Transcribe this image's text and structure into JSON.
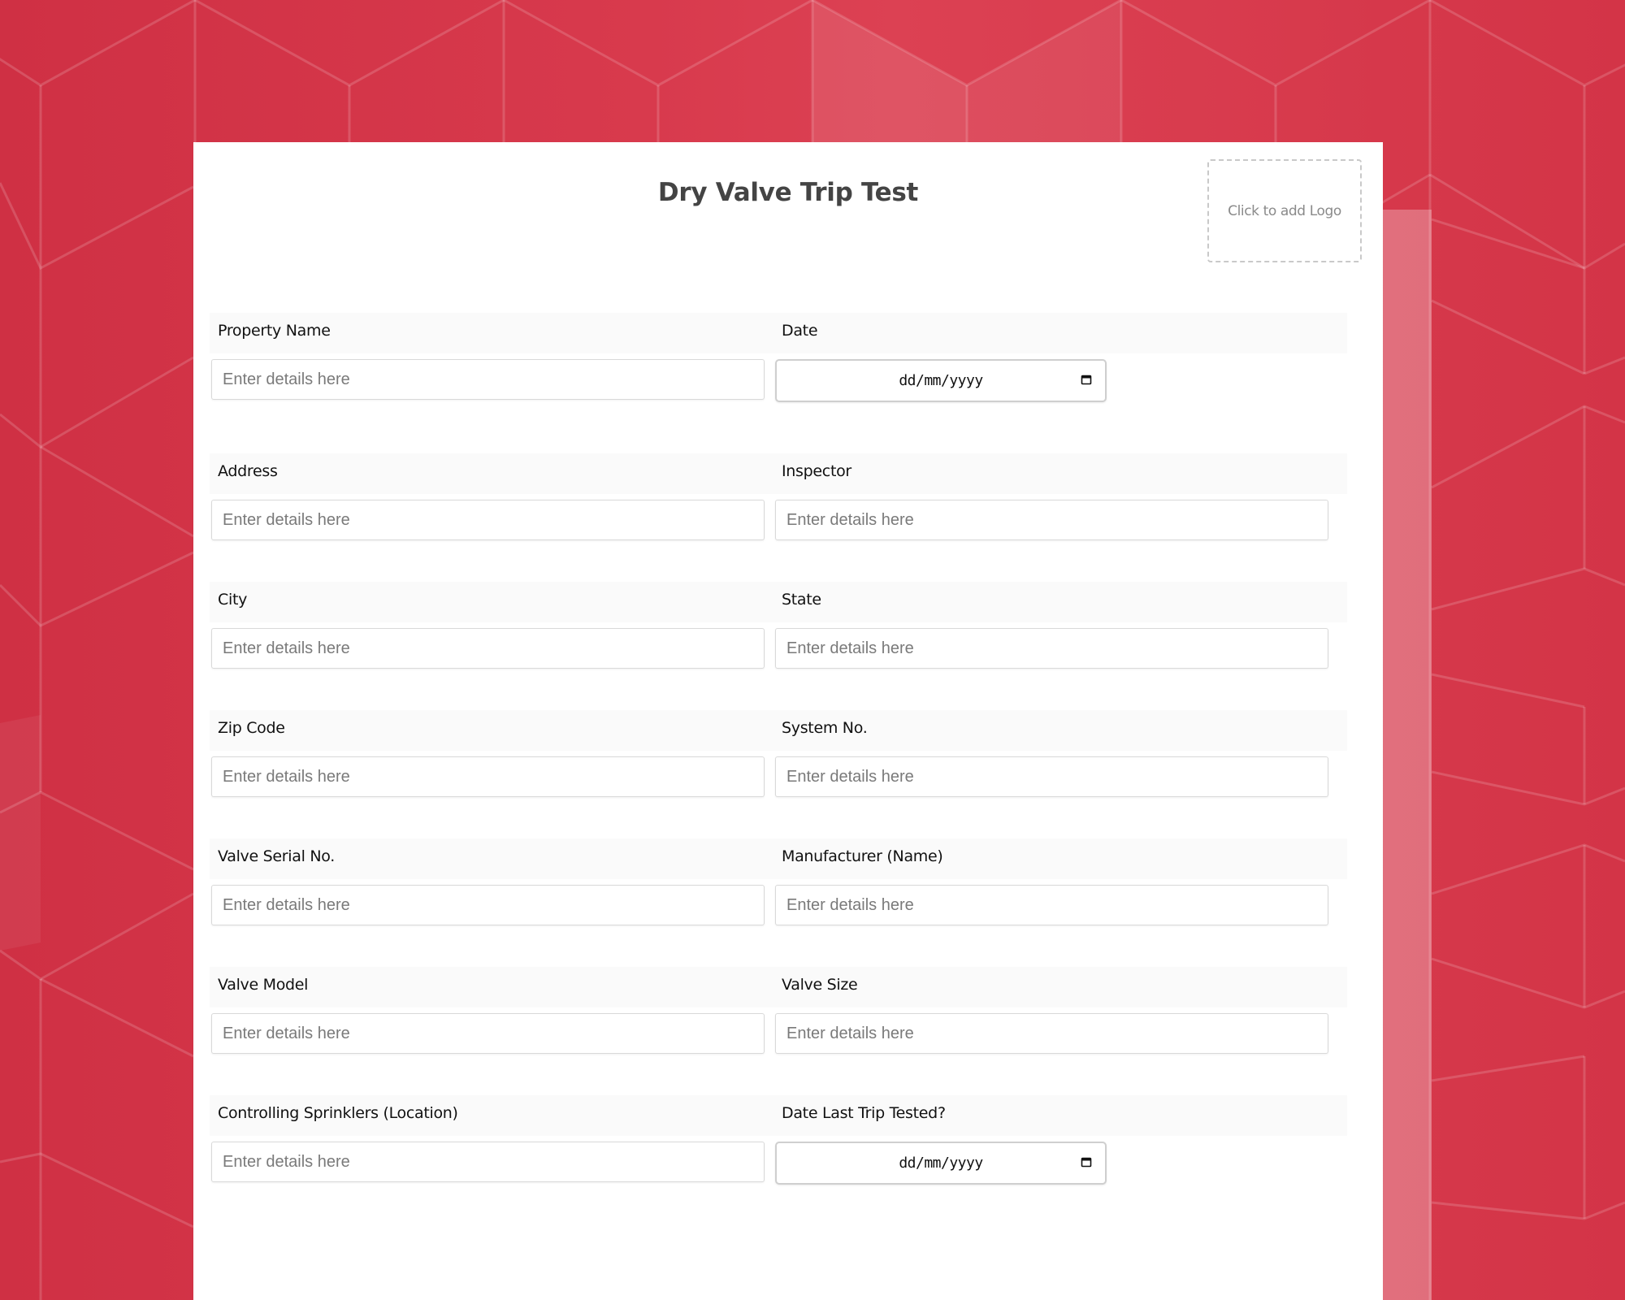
{
  "form": {
    "title": "Dry Valve Trip Test",
    "logo_placeholder": "Click to add Logo"
  },
  "rows": [
    {
      "left": {
        "label": "Property Name",
        "type": "text",
        "placeholder": "Enter details here",
        "value": ""
      },
      "right": {
        "label": "Date",
        "type": "date",
        "placeholder": "dd/mm/yyyy",
        "value": ""
      }
    },
    {
      "left": {
        "label": "Address",
        "type": "text",
        "placeholder": "Enter details here",
        "value": ""
      },
      "right": {
        "label": "Inspector",
        "type": "text",
        "placeholder": "Enter details here",
        "value": ""
      }
    },
    {
      "left": {
        "label": "City",
        "type": "text",
        "placeholder": "Enter details here",
        "value": ""
      },
      "right": {
        "label": "State",
        "type": "text",
        "placeholder": "Enter details here",
        "value": ""
      }
    },
    {
      "left": {
        "label": "Zip Code",
        "type": "text",
        "placeholder": "Enter details here",
        "value": ""
      },
      "right": {
        "label": "System No.",
        "type": "text",
        "placeholder": "Enter details here",
        "value": ""
      }
    },
    {
      "left": {
        "label": "Valve Serial No.",
        "type": "text",
        "placeholder": "Enter details here",
        "value": ""
      },
      "right": {
        "label": "Manufacturer (Name)",
        "type": "text",
        "placeholder": "Enter details here",
        "value": ""
      }
    },
    {
      "left": {
        "label": "Valve Model",
        "type": "text",
        "placeholder": "Enter details here",
        "value": ""
      },
      "right": {
        "label": "Valve Size",
        "type": "text",
        "placeholder": "Enter details here",
        "value": ""
      }
    },
    {
      "left": {
        "label": "Controlling Sprinklers (Location)",
        "type": "text",
        "placeholder": "Enter details here",
        "value": ""
      },
      "right": {
        "label": "Date Last Trip Tested?",
        "type": "date",
        "placeholder": "dd/mm/yyyy",
        "value": ""
      }
    }
  ],
  "icons": {
    "date_picker": "calendar-icon"
  },
  "colors": {
    "background": "#d6374a",
    "card": "#ffffff",
    "title": "#444444",
    "label_band": "#fafafa",
    "placeholder": "#7a7a7a"
  }
}
